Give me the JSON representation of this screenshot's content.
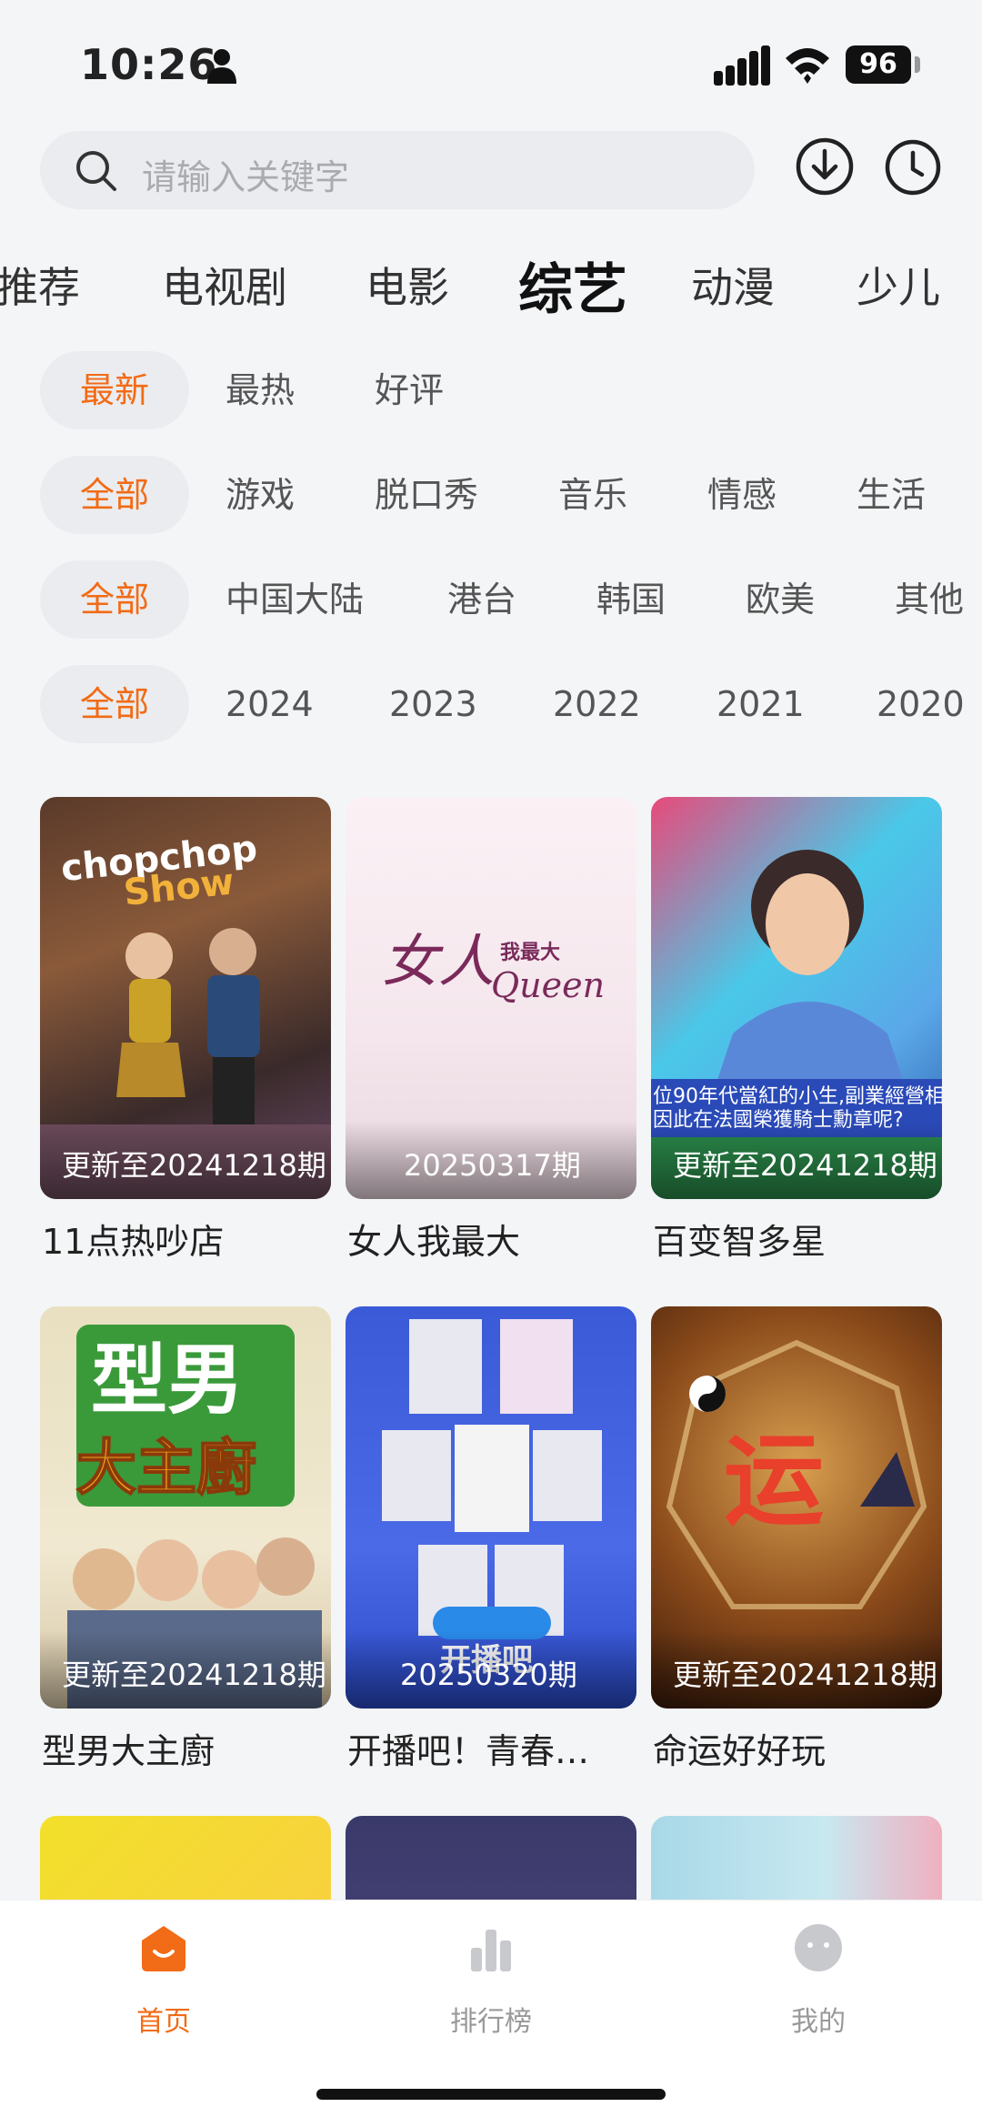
{
  "status_bar": {
    "time": "10:26",
    "battery": "96"
  },
  "search": {
    "placeholder": "请输入关键字"
  },
  "category_tabs": [
    "推荐",
    "电视剧",
    "电影",
    "综艺",
    "动漫",
    "少儿"
  ],
  "active_tab_index": 3,
  "filters": {
    "sort": [
      "最新",
      "最热",
      "好评"
    ],
    "genre": [
      "全部",
      "游戏",
      "脱口秀",
      "音乐",
      "情感",
      "生活"
    ],
    "region": [
      "全部",
      "中国大陆",
      "港台",
      "韩国",
      "欧美",
      "其他"
    ],
    "year": [
      "全部",
      "2024",
      "2023",
      "2022",
      "2021",
      "2020"
    ]
  },
  "cards": [
    {
      "title": "11点热吵店",
      "badge": "更新至20241218期"
    },
    {
      "title": "女人我最大",
      "badge": "20250317期"
    },
    {
      "title": "百变智多星",
      "badge": "更新至20241218期"
    },
    {
      "title": "型男大主廚",
      "badge": "更新至20241218期"
    },
    {
      "title": "开播吧！青春…",
      "badge": "20250320期"
    },
    {
      "title": "命运好好玩",
      "badge": "更新至20241218期"
    }
  ],
  "bottom_nav": [
    {
      "label": "首页"
    },
    {
      "label": "排行榜"
    },
    {
      "label": "我的"
    }
  ],
  "colors": {
    "accent": "#f26b16",
    "chip_bg": "#ebecef",
    "background": "#f4f5f7"
  }
}
